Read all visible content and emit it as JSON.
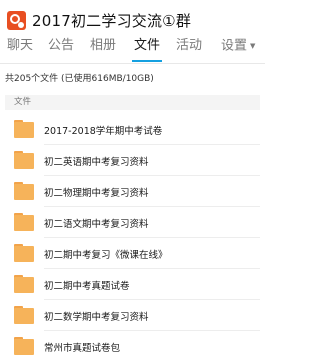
{
  "header": {
    "group_title": "2017初二学习交流①群",
    "avatar_icon": "qq-group-avatar-icon",
    "accent_color": "#15a0e0"
  },
  "tabs": [
    {
      "label": "聊天",
      "active": false
    },
    {
      "label": "公告",
      "active": false
    },
    {
      "label": "相册",
      "active": false
    },
    {
      "label": "文件",
      "active": true
    },
    {
      "label": "活动",
      "active": false
    },
    {
      "label": "设置",
      "active": false,
      "icon": "caret-down-icon"
    }
  ],
  "summary": "共205个文件 (已使用616MB/10GB)",
  "section_header": "文件",
  "files": [
    {
      "name": "2017-2018学年期中考试卷",
      "icon": "folder-icon"
    },
    {
      "name": "初二英语期中考复习资料",
      "icon": "folder-icon"
    },
    {
      "name": "初二物理期中考复习资料",
      "icon": "folder-icon"
    },
    {
      "name": "初二语文期中考复习资料",
      "icon": "folder-icon"
    },
    {
      "name": "初二期中考复习《微课在线》",
      "icon": "folder-icon"
    },
    {
      "name": "初二期中考真题试卷",
      "icon": "folder-icon"
    },
    {
      "name": "初二数学期中考复习资料",
      "icon": "folder-icon"
    },
    {
      "name": "常州市真题试卷包",
      "icon": "folder-icon"
    }
  ]
}
